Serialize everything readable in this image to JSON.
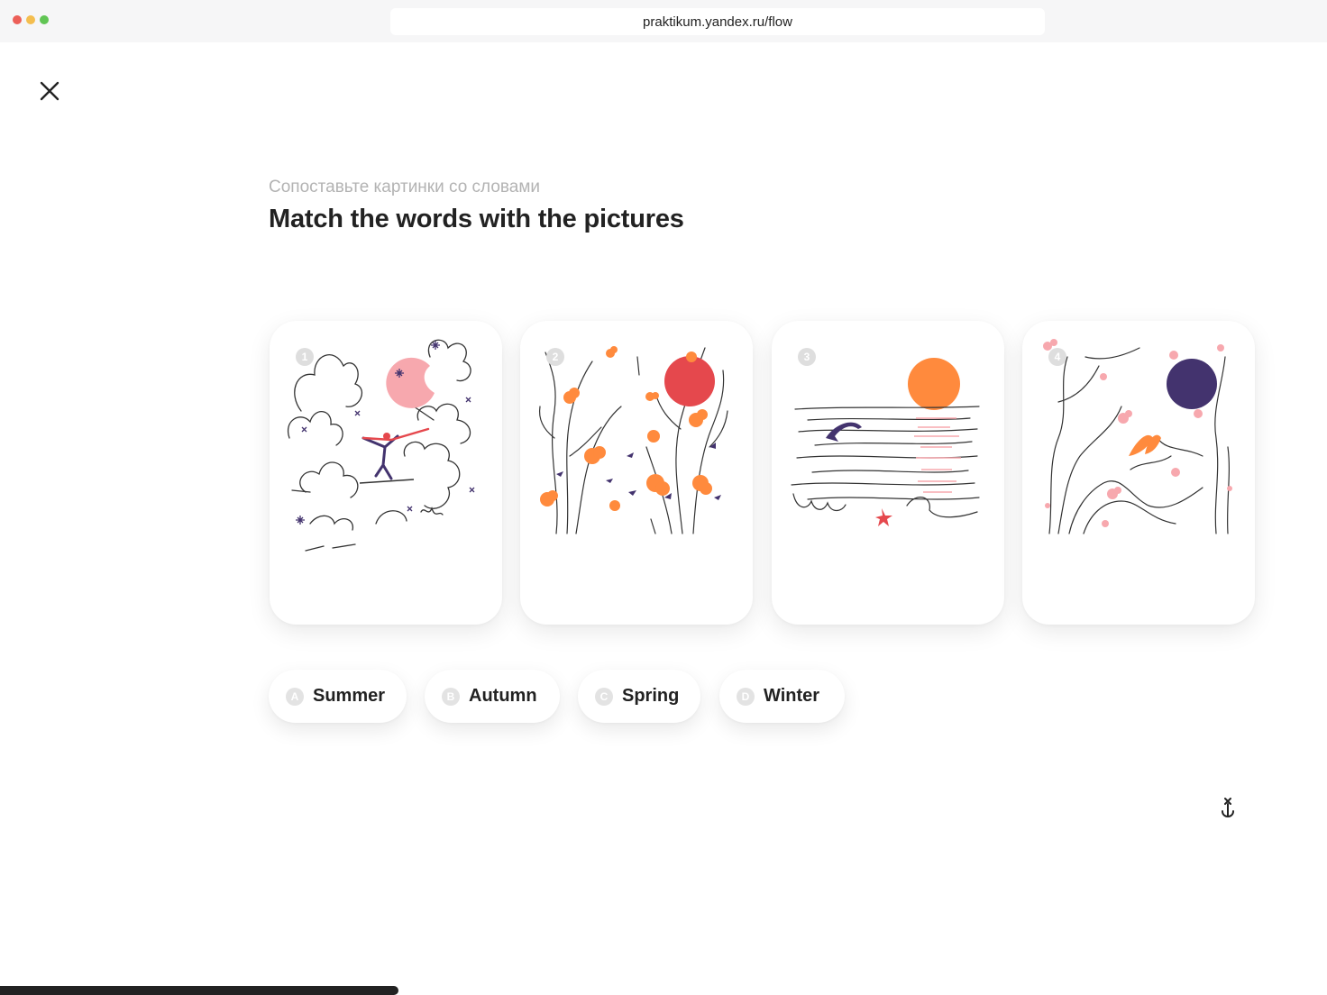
{
  "browser": {
    "url": "praktikum.yandex.ru/flow",
    "colors": {
      "red": "#ec5f58",
      "yellow": "#f4be4f",
      "green": "#61c554"
    }
  },
  "exercise": {
    "instruction_ru": "Сопоставьте картинки со словами",
    "title": "Match the words with the pictures"
  },
  "cards": [
    {
      "number": "1",
      "illustration": "winter-skier-snow-icon"
    },
    {
      "number": "2",
      "illustration": "autumn-trees-leaves-icon"
    },
    {
      "number": "3",
      "illustration": "summer-sea-dolphin-icon"
    },
    {
      "number": "4",
      "illustration": "spring-blossom-birds-icon"
    }
  ],
  "words": [
    {
      "letter": "A",
      "label": "Summer"
    },
    {
      "letter": "B",
      "label": "Autumn"
    },
    {
      "letter": "C",
      "label": "Spring"
    },
    {
      "letter": "D",
      "label": "Winter"
    }
  ],
  "icons": {
    "close": "close-icon",
    "anchor": "anchor-icon"
  },
  "progress": {
    "fraction": 0.3
  },
  "palette": {
    "orange": "#ff8a3d",
    "red": "#e5484d",
    "pink": "#f7a8ae",
    "purple": "#43336e"
  }
}
